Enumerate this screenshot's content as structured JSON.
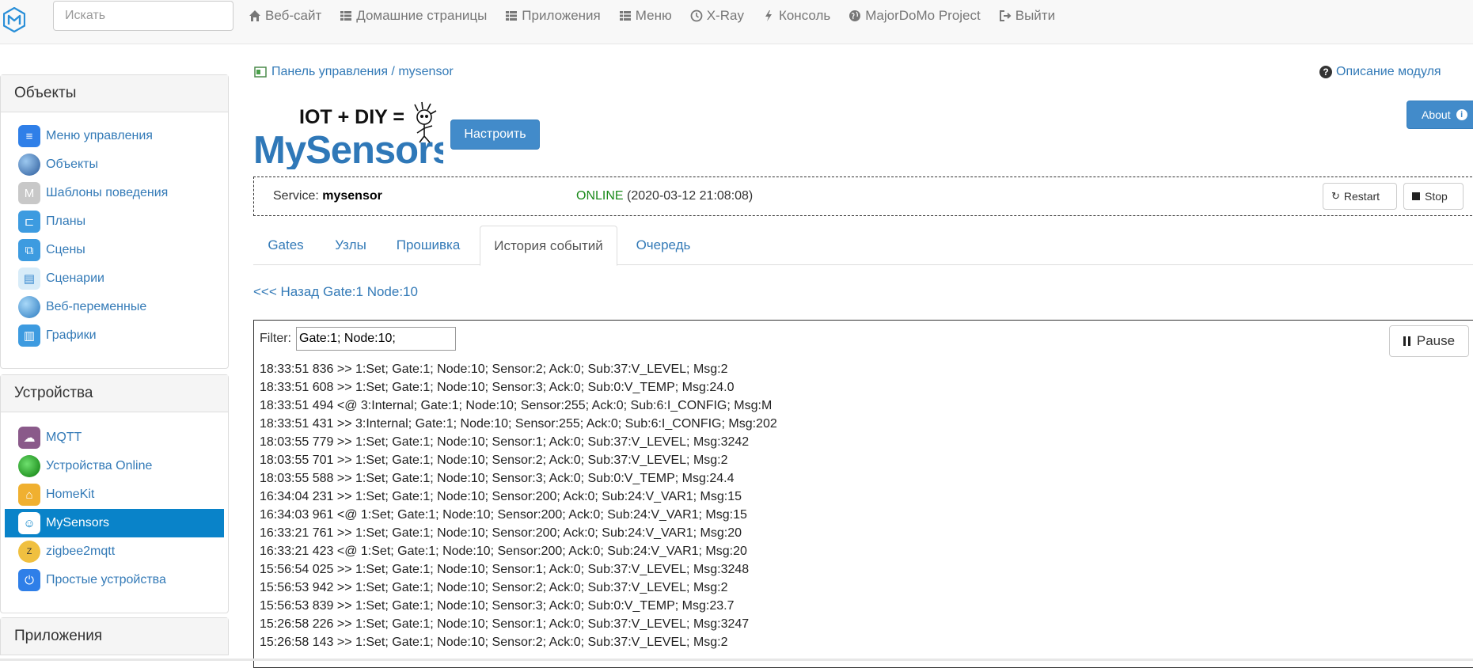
{
  "navbar": {
    "search_placeholder": "Искать",
    "links": [
      {
        "label": "Веб-сайт",
        "icon": "home-icon"
      },
      {
        "label": "Домашние страницы",
        "icon": "th-list-icon"
      },
      {
        "label": "Приложения",
        "icon": "th-list-icon"
      },
      {
        "label": "Меню",
        "icon": "th-list-icon"
      },
      {
        "label": "X-Ray",
        "icon": "clock-icon"
      },
      {
        "label": "Консоль",
        "icon": "flash-icon"
      },
      {
        "label": "MajorDoMo Project",
        "icon": "globe-icon"
      },
      {
        "label": "Выйти",
        "icon": "log-out-icon"
      }
    ]
  },
  "sidebar": {
    "objects_title": "Объекты",
    "objects_items": [
      {
        "label": "Меню управления",
        "icon": "menu-icon",
        "color": "#2f7fe8"
      },
      {
        "label": "Объекты",
        "icon": "globe-icon",
        "color": "#3a6fb0"
      },
      {
        "label": "Шаблоны поведения",
        "icon": "template-icon",
        "color": "#c8c8c8"
      },
      {
        "label": "Планы",
        "icon": "plan-icon",
        "color": "#3d9be0"
      },
      {
        "label": "Сцены",
        "icon": "scenes-icon",
        "color": "#3d9be0"
      },
      {
        "label": "Сценарии",
        "icon": "scripts-icon",
        "color": "#7ab8e0"
      },
      {
        "label": "Веб-переменные",
        "icon": "web-vars-icon",
        "color": "#3a8ad0"
      },
      {
        "label": "Графики",
        "icon": "chart-icon",
        "color": "#3d9be0"
      }
    ],
    "devices_title": "Устройства",
    "devices_items": [
      {
        "label": "MQTT",
        "icon": "mqtt-icon",
        "color": "#8a5a8a"
      },
      {
        "label": "Устройства Online",
        "icon": "online-icon",
        "color": "#1e9e1e"
      },
      {
        "label": "HomeKit",
        "icon": "homekit-icon",
        "color": "#f0b030"
      },
      {
        "label": "MySensors",
        "icon": "mysensors-icon",
        "color": "#ffffff",
        "active": true
      },
      {
        "label": "zigbee2mqtt",
        "icon": "zigbee-icon",
        "color": "#f0c040"
      },
      {
        "label": "Простые устройства",
        "icon": "power-icon",
        "color": "#2f7fe8"
      }
    ],
    "apps_title": "Приложения"
  },
  "main": {
    "breadcrumb": {
      "root": "Панель управления",
      "sep": " / ",
      "current": "mysensor"
    },
    "module_help": "Описание модуля",
    "about_label": "About",
    "logo_text_top": "IOT + DIY =",
    "logo_text_main": "MySensors",
    "configure_label": "Настроить",
    "service": {
      "label": "Service:",
      "name": "mysensor",
      "status": "ONLINE",
      "status_color": "#1a8a1a",
      "time": "(2020-03-12 21:08:08)",
      "restart_label": "Restart",
      "stop_label": "Stop"
    },
    "tabs": [
      {
        "label": "Gates"
      },
      {
        "label": "Узлы"
      },
      {
        "label": "Прошивка"
      },
      {
        "label": "История событий",
        "active": true
      },
      {
        "label": "Очередь"
      }
    ],
    "back_link": "<<< Назад Gate:1 Node:10",
    "log": {
      "filter_label": "Filter:",
      "filter_value": "Gate:1; Node:10;",
      "pause_label": "Pause",
      "lines": [
        "18:33:51 836 >> 1:Set; Gate:1; Node:10; Sensor:2; Ack:0; Sub:37:V_LEVEL; Msg:2",
        "18:33:51 608 >> 1:Set; Gate:1; Node:10; Sensor:3; Ack:0; Sub:0:V_TEMP; Msg:24.0",
        "18:33:51 494 <@ 3:Internal; Gate:1; Node:10; Sensor:255; Ack:0; Sub:6:I_CONFIG; Msg:M",
        "18:33:51 431 >> 3:Internal; Gate:1; Node:10; Sensor:255; Ack:0; Sub:6:I_CONFIG; Msg:202",
        "18:03:55 779 >> 1:Set; Gate:1; Node:10; Sensor:1; Ack:0; Sub:37:V_LEVEL; Msg:3242",
        "18:03:55 701 >> 1:Set; Gate:1; Node:10; Sensor:2; Ack:0; Sub:37:V_LEVEL; Msg:2",
        "18:03:55 588 >> 1:Set; Gate:1; Node:10; Sensor:3; Ack:0; Sub:0:V_TEMP; Msg:24.4",
        "16:34:04 231 >> 1:Set; Gate:1; Node:10; Sensor:200; Ack:0; Sub:24:V_VAR1; Msg:15",
        "16:34:03 961 <@ 1:Set; Gate:1; Node:10; Sensor:200; Ack:0; Sub:24:V_VAR1; Msg:15",
        "16:33:21 761 >> 1:Set; Gate:1; Node:10; Sensor:200; Ack:0; Sub:24:V_VAR1; Msg:20",
        "16:33:21 423 <@ 1:Set; Gate:1; Node:10; Sensor:200; Ack:0; Sub:24:V_VAR1; Msg:20",
        "15:56:54 025 >> 1:Set; Gate:1; Node:10; Sensor:1; Ack:0; Sub:37:V_LEVEL; Msg:3248",
        "15:56:53 942 >> 1:Set; Gate:1; Node:10; Sensor:2; Ack:0; Sub:37:V_LEVEL; Msg:2",
        "15:56:53 839 >> 1:Set; Gate:1; Node:10; Sensor:3; Ack:0; Sub:0:V_TEMP; Msg:23.7",
        "15:26:58 226 >> 1:Set; Gate:1; Node:10; Sensor:1; Ack:0; Sub:37:V_LEVEL; Msg:3247",
        "15:26:58 143 >> 1:Set; Gate:1; Node:10; Sensor:2; Ack:0; Sub:37:V_LEVEL; Msg:2"
      ]
    }
  }
}
